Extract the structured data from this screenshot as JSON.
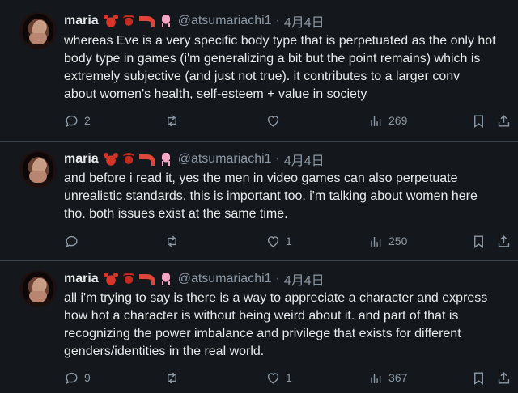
{
  "tweets": [
    {
      "name": "maria",
      "handle": "@atsumariachi1",
      "separator": "·",
      "date": "4月4日",
      "text_lines": [
        "whereas Eve is a very specific body type that is perpetuated as the only hot",
        "body type in games (i'm generalizing a bit but the point remains) which is",
        "extremely subjective (and just not true). it contributes to a larger conv",
        "about women's health, self-esteem + value in society"
      ],
      "replies": "2",
      "retweets": "",
      "likes": "",
      "views": "269"
    },
    {
      "name": "maria",
      "handle": "@atsumariachi1",
      "separator": "·",
      "date": "4月4日",
      "text_lines": [
        "and before i read it, yes the men in video games can also perpetuate",
        "unrealistic standards. this is important too. i'm talking about women here",
        "tho. both issues exist at the same time."
      ],
      "replies": "",
      "retweets": "",
      "likes": "1",
      "views": "250"
    },
    {
      "name": "maria",
      "handle": "@atsumariachi1",
      "separator": "·",
      "date": "4月4日",
      "text_lines": [
        "all i'm trying to say is there is a way to appreciate a character and express",
        "how hot a character is without being weird about it. and part of that is",
        "recognizing the power imbalance and privilege that exists for different",
        "genders/identities in the real world."
      ],
      "replies": "9",
      "retweets": "",
      "likes": "1",
      "views": "367"
    }
  ],
  "icons": {
    "reply": "reply-icon",
    "retweet": "retweet-icon",
    "like": "heart-icon",
    "views": "views-icon",
    "bookmark": "bookmark-icon",
    "share": "share-icon"
  },
  "colors": {
    "background": "#14181c",
    "text": "#e7e9ea",
    "muted": "#8b98a5",
    "divider": "#38444d"
  }
}
